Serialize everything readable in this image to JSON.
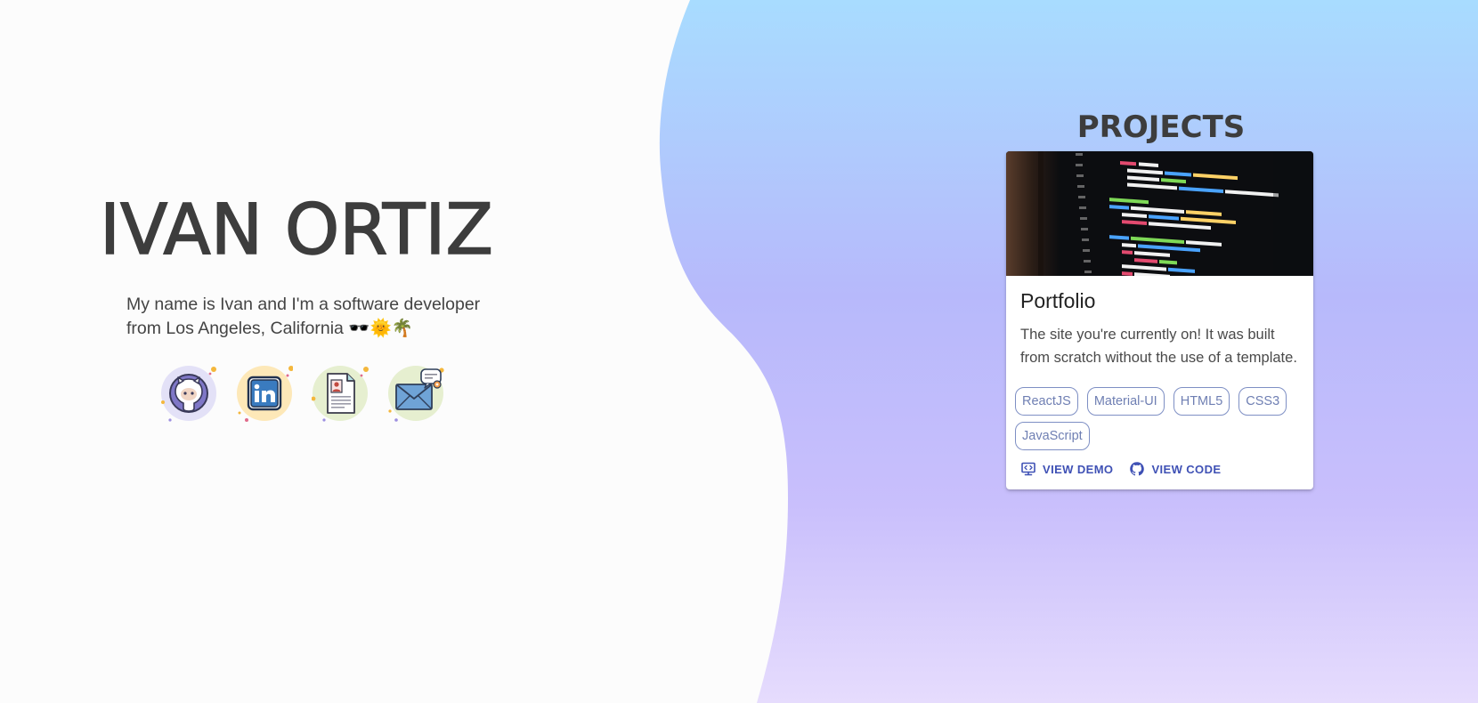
{
  "hero": {
    "name": "IVAN ORTIZ",
    "intro": "My name is Ivan and I'm a software developer from Los Angeles, California 🕶️🌞🌴",
    "social_links": [
      {
        "icon": "github-icon",
        "accent": "#e3e1f7"
      },
      {
        "icon": "linkedin-icon",
        "accent": "#fde8b8"
      },
      {
        "icon": "resume-icon",
        "accent": "#e6efd0"
      },
      {
        "icon": "email-icon",
        "accent": "#e6efd0"
      }
    ]
  },
  "projects": {
    "title": "PROJECTS",
    "cards": [
      {
        "title": "Portfolio",
        "description": "The site you're currently on! It was built from scratch without the use of a template.",
        "tags": [
          "ReactJS",
          "Material-UI",
          "HTML5",
          "CSS3",
          "JavaScript"
        ],
        "actions": {
          "demo_label": "VIEW DEMO",
          "code_label": "VIEW CODE"
        }
      }
    ]
  },
  "colors": {
    "gradient_top": "#a8dcff",
    "gradient_mid": "#b7b9fb",
    "gradient_bottom": "#e6dcfd",
    "heading": "#3d3d3d",
    "chip_border": "#7e8fc4",
    "action": "#3f51b5"
  }
}
